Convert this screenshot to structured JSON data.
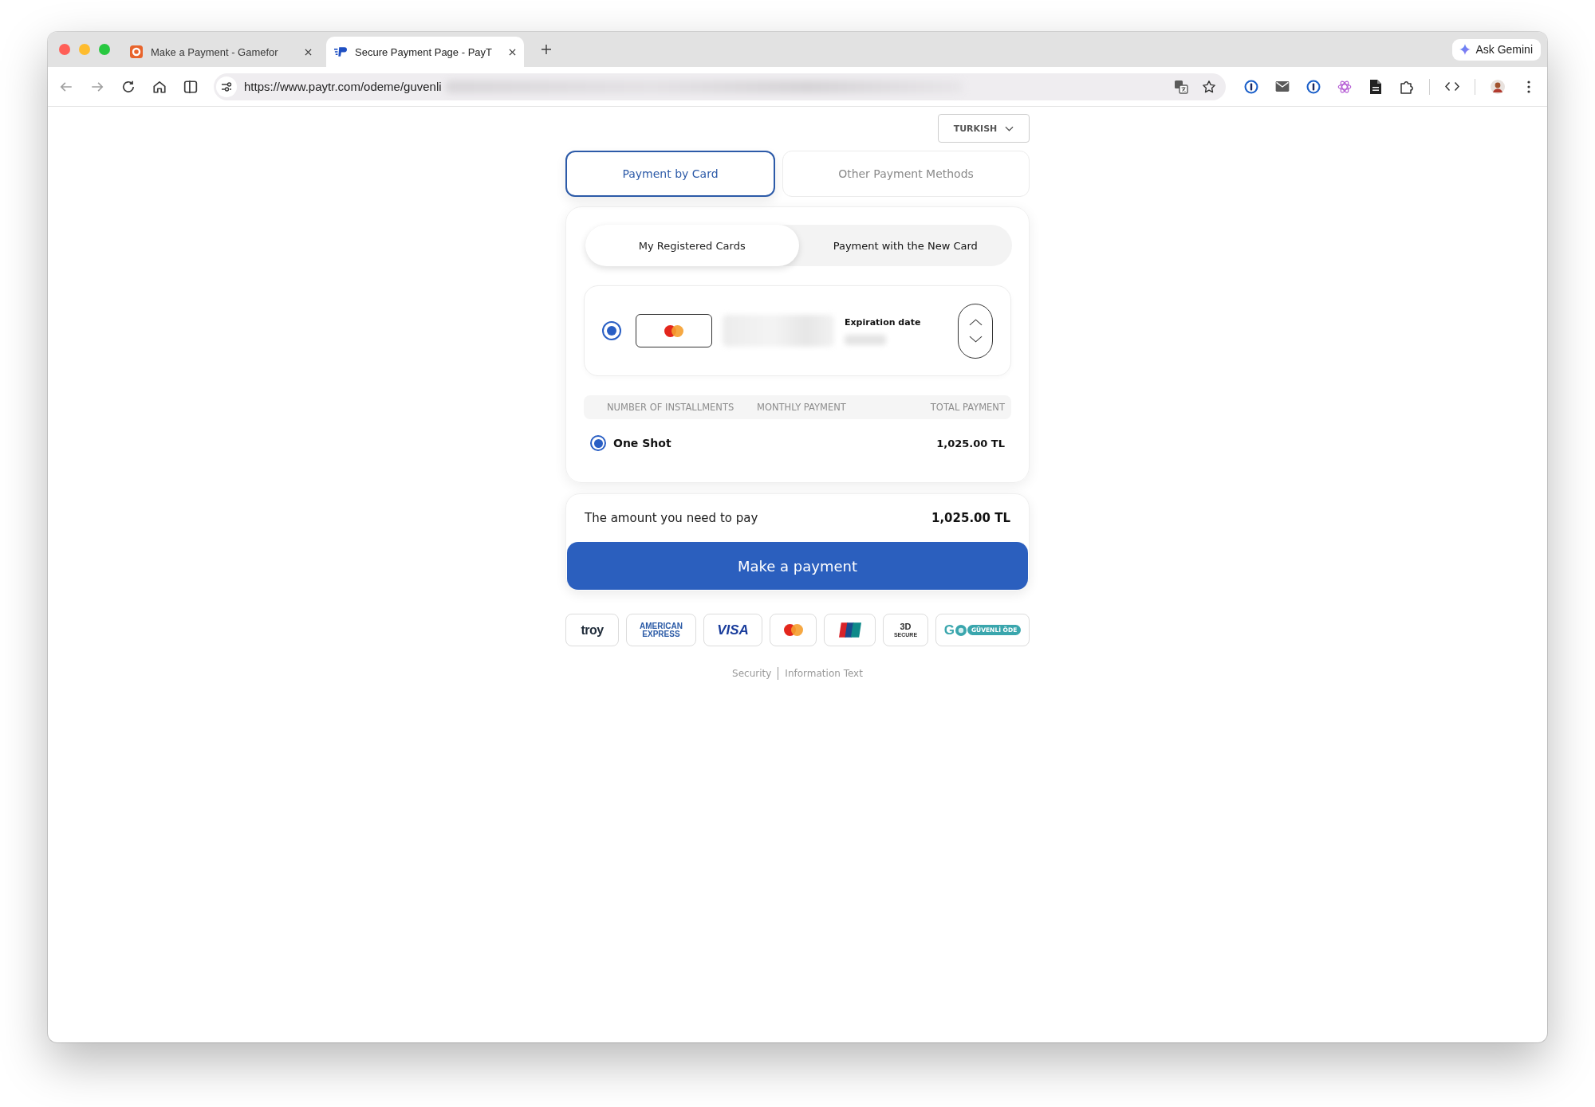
{
  "browser": {
    "tabs": [
      {
        "kind": "ring",
        "title": "Make a Payment - Gamefor",
        "selected": false
      },
      {
        "kind": "stripes",
        "title": "Secure Payment Page - PayT",
        "selected": true
      }
    ],
    "assistant_button": "Ask Gemini",
    "url": "https://www.paytr.com/odeme/guvenli"
  },
  "language_selector": "TURKISH",
  "payment_tabs": [
    {
      "label": "Payment by Card",
      "selected": true
    },
    {
      "label": "Other Payment Methods",
      "selected": false
    }
  ],
  "card_tabs": [
    {
      "label": "My Registered Cards",
      "selected": true
    },
    {
      "label": "Payment with the New Card",
      "selected": false
    }
  ],
  "saved_cards": [
    {
      "kind": "mastercard",
      "expiry_label": "Expiration date",
      "selected": true
    }
  ],
  "installments": {
    "columns": [
      "NUMBER OF INSTALLMENTS",
      "MONTHLY PAYMENT",
      "TOTAL PAYMENT"
    ],
    "rows": [
      {
        "label": "One Shot",
        "total": "1,025.00 TL",
        "selected": true
      }
    ]
  },
  "summary": {
    "label": "The amount you need to pay",
    "amount": "1,025.00 TL",
    "button": "Make a payment"
  },
  "payment_logos": [
    {
      "kind": "troy",
      "text": "troy"
    },
    {
      "kind": "amex",
      "lines": [
        "AMERICAN",
        "EXPRESS"
      ]
    },
    {
      "kind": "visa",
      "text": "VISA"
    },
    {
      "kind": "mastercard"
    },
    {
      "kind": "unionpay"
    },
    {
      "kind": "secure3d",
      "lines": [
        "3D",
        "SECURE"
      ]
    },
    {
      "kind": "guvenli",
      "mark": "G",
      "text": "GÜVENLİ ÖDE"
    }
  ],
  "footer_links": [
    "Security",
    "Information Text"
  ]
}
